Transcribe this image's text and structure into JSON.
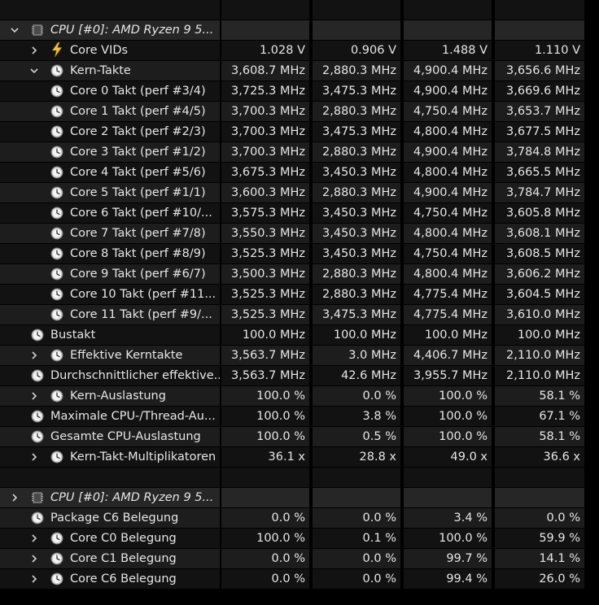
{
  "rows": [
    {
      "type": "blank"
    },
    {
      "type": "header",
      "indent": 0,
      "expander": "expanded",
      "icon": "chip-icon",
      "label": "CPU [#0]: AMD Ryzen 9 5...",
      "values": [
        "",
        "",
        "",
        ""
      ]
    },
    {
      "type": "data",
      "indent": 1,
      "expander": "collapsed",
      "icon": "lightning-icon",
      "label": "Core VIDs",
      "values": [
        "1.028 V",
        "0.906 V",
        "1.488 V",
        "1.110 V"
      ]
    },
    {
      "type": "data",
      "indent": 1,
      "expander": "expanded",
      "icon": "clock-icon",
      "label": "Kern-Takte",
      "values": [
        "3,608.7 MHz",
        "2,880.3 MHz",
        "4,900.4 MHz",
        "3,656.6 MHz"
      ]
    },
    {
      "type": "data",
      "indent": 2,
      "expander": "none",
      "icon": "clock-icon",
      "label": "Core 0 Takt (perf #3/4)",
      "values": [
        "3,725.3 MHz",
        "3,475.3 MHz",
        "4,900.4 MHz",
        "3,669.6 MHz"
      ]
    },
    {
      "type": "data",
      "indent": 2,
      "expander": "none",
      "icon": "clock-icon",
      "label": "Core 1 Takt (perf #4/5)",
      "values": [
        "3,700.3 MHz",
        "2,880.3 MHz",
        "4,750.4 MHz",
        "3,653.7 MHz"
      ]
    },
    {
      "type": "data",
      "indent": 2,
      "expander": "none",
      "icon": "clock-icon",
      "label": "Core 2 Takt (perf #2/3)",
      "values": [
        "3,700.3 MHz",
        "3,475.3 MHz",
        "4,800.4 MHz",
        "3,677.5 MHz"
      ]
    },
    {
      "type": "data",
      "indent": 2,
      "expander": "none",
      "icon": "clock-icon",
      "label": "Core 3 Takt (perf #1/2)",
      "values": [
        "3,700.3 MHz",
        "2,880.3 MHz",
        "4,900.4 MHz",
        "3,784.8 MHz"
      ]
    },
    {
      "type": "data",
      "indent": 2,
      "expander": "none",
      "icon": "clock-icon",
      "label": "Core 4 Takt (perf #5/6)",
      "values": [
        "3,675.3 MHz",
        "3,450.3 MHz",
        "4,800.4 MHz",
        "3,665.5 MHz"
      ]
    },
    {
      "type": "data",
      "indent": 2,
      "expander": "none",
      "icon": "clock-icon",
      "label": "Core 5 Takt (perf #1/1)",
      "values": [
        "3,600.3 MHz",
        "2,880.3 MHz",
        "4,900.4 MHz",
        "3,784.7 MHz"
      ]
    },
    {
      "type": "data",
      "indent": 2,
      "expander": "none",
      "icon": "clock-icon",
      "label": "Core 6 Takt (perf #10/...",
      "values": [
        "3,575.3 MHz",
        "3,450.3 MHz",
        "4,750.4 MHz",
        "3,605.8 MHz"
      ]
    },
    {
      "type": "data",
      "indent": 2,
      "expander": "none",
      "icon": "clock-icon",
      "label": "Core 7 Takt (perf #7/8)",
      "values": [
        "3,550.3 MHz",
        "3,450.3 MHz",
        "4,800.4 MHz",
        "3,608.1 MHz"
      ]
    },
    {
      "type": "data",
      "indent": 2,
      "expander": "none",
      "icon": "clock-icon",
      "label": "Core 8 Takt (perf #8/9)",
      "values": [
        "3,525.3 MHz",
        "3,450.3 MHz",
        "4,750.4 MHz",
        "3,608.5 MHz"
      ]
    },
    {
      "type": "data",
      "indent": 2,
      "expander": "none",
      "icon": "clock-icon",
      "label": "Core 9 Takt (perf #6/7)",
      "values": [
        "3,500.3 MHz",
        "2,880.3 MHz",
        "4,800.4 MHz",
        "3,606.2 MHz"
      ]
    },
    {
      "type": "data",
      "indent": 2,
      "expander": "none",
      "icon": "clock-icon",
      "label": "Core 10 Takt (perf #11...",
      "values": [
        "3,525.3 MHz",
        "2,880.3 MHz",
        "4,775.4 MHz",
        "3,604.5 MHz"
      ]
    },
    {
      "type": "data",
      "indent": 2,
      "expander": "none",
      "icon": "clock-icon",
      "label": "Core 11 Takt (perf #9/...",
      "values": [
        "3,525.3 MHz",
        "3,475.3 MHz",
        "4,775.4 MHz",
        "3,610.0 MHz"
      ]
    },
    {
      "type": "data",
      "indent": 0,
      "expander": "none",
      "icon": "clock-icon",
      "label": "Bustakt",
      "values": [
        "100.0 MHz",
        "100.0 MHz",
        "100.0 MHz",
        "100.0 MHz"
      ]
    },
    {
      "type": "data",
      "indent": 1,
      "expander": "collapsed",
      "icon": "clock-icon",
      "label": "Effektive Kerntakte",
      "values": [
        "3,563.7 MHz",
        "3.0 MHz",
        "4,406.7 MHz",
        "2,110.0 MHz"
      ]
    },
    {
      "type": "data",
      "indent": 0,
      "expander": "none",
      "icon": "clock-icon",
      "label": "Durchschnittlicher effektive...",
      "values": [
        "3,563.7 MHz",
        "42.6 MHz",
        "3,955.7 MHz",
        "2,110.0 MHz"
      ]
    },
    {
      "type": "data",
      "indent": 1,
      "expander": "collapsed",
      "icon": "clock-icon",
      "label": "Kern-Auslastung",
      "values": [
        "100.0 %",
        "0.0 %",
        "100.0 %",
        "58.1 %"
      ]
    },
    {
      "type": "data",
      "indent": 0,
      "expander": "none",
      "icon": "clock-icon",
      "label": "Maximale CPU-/Thread-Au...",
      "values": [
        "100.0 %",
        "3.8 %",
        "100.0 %",
        "67.1 %"
      ]
    },
    {
      "type": "data",
      "indent": 0,
      "expander": "none",
      "icon": "clock-icon",
      "label": "Gesamte CPU-Auslastung",
      "values": [
        "100.0 %",
        "0.5 %",
        "100.0 %",
        "58.1 %"
      ]
    },
    {
      "type": "data",
      "indent": 1,
      "expander": "collapsed",
      "icon": "clock-icon",
      "label": "Kern-Takt-Multiplikatoren",
      "values": [
        "36.1 x",
        "28.8 x",
        "49.0 x",
        "36.6 x"
      ]
    },
    {
      "type": "blank"
    },
    {
      "type": "header",
      "indent": 0,
      "expander": "collapsed",
      "icon": "chip-icon",
      "label": "CPU [#0]: AMD Ryzen 9 5...",
      "values": [
        "",
        "",
        "",
        ""
      ]
    },
    {
      "type": "data",
      "indent": 0,
      "expander": "none",
      "icon": "clock-icon",
      "label": "Package C6 Belegung",
      "values": [
        "0.0 %",
        "0.0 %",
        "3.4 %",
        "0.0 %"
      ]
    },
    {
      "type": "data",
      "indent": 1,
      "expander": "collapsed",
      "icon": "clock-icon",
      "label": "Core C0 Belegung",
      "values": [
        "100.0 %",
        "0.1 %",
        "100.0 %",
        "59.9 %"
      ]
    },
    {
      "type": "data",
      "indent": 1,
      "expander": "collapsed",
      "icon": "clock-icon",
      "label": "Core C1 Belegung",
      "values": [
        "0.0 %",
        "0.0 %",
        "99.7 %",
        "14.1 %"
      ]
    },
    {
      "type": "data",
      "indent": 1,
      "expander": "collapsed",
      "icon": "clock-icon",
      "label": "Core C6 Belegung",
      "values": [
        "0.0 %",
        "0.0 %",
        "99.4 %",
        "26.0 %"
      ]
    }
  ]
}
